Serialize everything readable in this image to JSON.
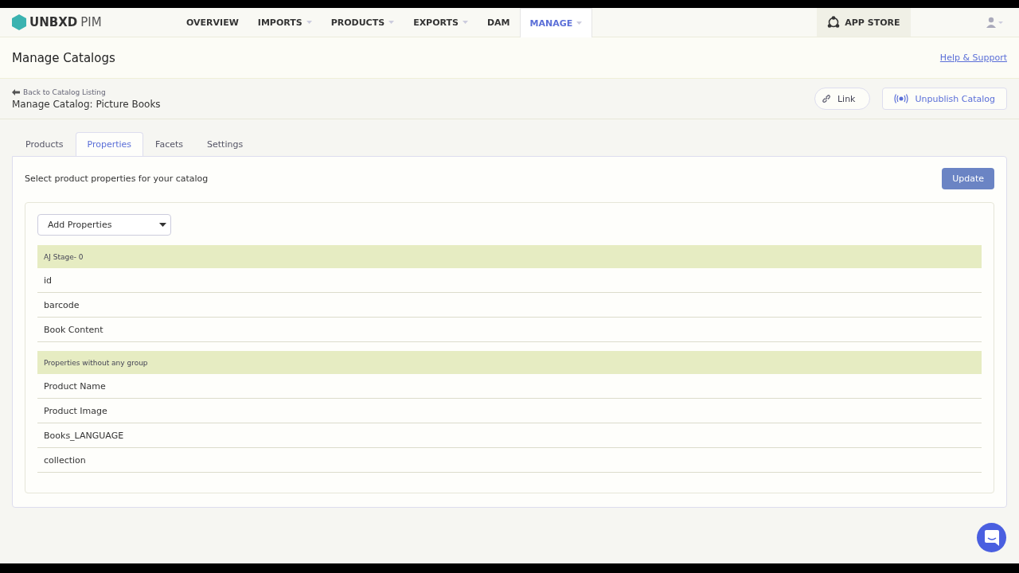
{
  "brand": {
    "name": "UNBXD",
    "product": "PIM"
  },
  "nav": [
    {
      "label": "OVERVIEW",
      "selected": false,
      "has_menu": false
    },
    {
      "label": "IMPORTS",
      "selected": false,
      "has_menu": true
    },
    {
      "label": "PRODUCTS",
      "selected": false,
      "has_menu": true
    },
    {
      "label": "EXPORTS",
      "selected": false,
      "has_menu": true
    },
    {
      "label": "DAM",
      "selected": false,
      "has_menu": false
    },
    {
      "label": "MANAGE",
      "selected": true,
      "has_menu": true
    }
  ],
  "app_store": "APP STORE",
  "page_title": "Manage Catalogs",
  "help_link": "Help & Support",
  "back_link": "Back to Catalog Listing",
  "catalog_title": "Manage Catalog: Picture Books",
  "actions": [
    {
      "kind": "link",
      "label": "Link"
    },
    {
      "kind": "unpublish",
      "label": "Unpublish Catalog"
    }
  ],
  "tabs": [
    {
      "label": "Products",
      "selected": false
    },
    {
      "label": "Properties",
      "selected": true
    },
    {
      "label": "Facets",
      "selected": false
    },
    {
      "label": "Settings",
      "selected": false
    }
  ],
  "instruction": "Select product properties for your catalog",
  "update_button": "Update",
  "add_dropdown": "Add Properties",
  "groups": [
    {
      "name": "AJ Stage- 0",
      "properties": [
        "id",
        "barcode",
        "Book Content"
      ]
    },
    {
      "name": "Properties without any group",
      "properties": [
        "Product Name",
        "Product Image",
        "Books_LANGUAGE",
        "collection"
      ]
    }
  ]
}
